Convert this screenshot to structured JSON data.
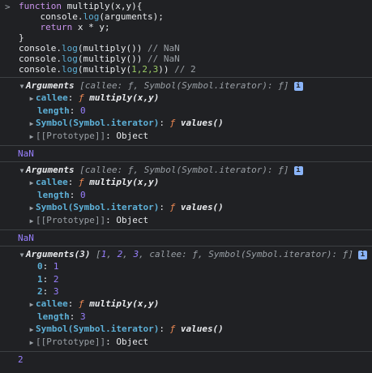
{
  "input": {
    "prompt_icon": "chevron-right-icon",
    "lines": [
      {
        "a": "function",
        "b": " multiply(x,y){"
      },
      {
        "a": "    console.",
        "b": "log",
        "c": "(arguments);"
      },
      {
        "a": "    return",
        "b": " x * y;"
      },
      {
        "a": "}"
      },
      {
        "a": "console.",
        "b": "log",
        "c": "(multiply()) ",
        "d": "// NaN"
      },
      {
        "a": "console.",
        "b": "log",
        "c": "(multiply()) ",
        "d": "// NaN"
      },
      {
        "a": "console.",
        "b": "log",
        "c": "(multiply(",
        "n": "1,2,3",
        "e": ")) ",
        "d": "// 2"
      }
    ]
  },
  "entries": [
    {
      "header_name": "Arguments",
      "header_preview": "[callee: ƒ, Symbol(Symbol.iterator): ƒ]",
      "info": "i",
      "rows": [
        {
          "key": "callee",
          "sep": ": ",
          "f": "ƒ",
          "val": " multiply(x,y)",
          "type": "func",
          "expandable": true
        },
        {
          "key": "length",
          "sep": ": ",
          "val": "0",
          "type": "num",
          "expandable": false
        },
        {
          "key": "Symbol(Symbol.iterator)",
          "sep": ": ",
          "f": "ƒ",
          "val": " values()",
          "type": "func",
          "expandable": true
        },
        {
          "key": "[[Prototype]]",
          "sep": ": ",
          "val": "Object",
          "type": "proto",
          "expandable": true
        }
      ]
    },
    {
      "nan": "NaN"
    },
    {
      "header_name": "Arguments",
      "header_preview": "[callee: ƒ, Symbol(Symbol.iterator): ƒ]",
      "info": "i",
      "rows": [
        {
          "key": "callee",
          "sep": ": ",
          "f": "ƒ",
          "val": " multiply(x,y)",
          "type": "func",
          "expandable": true
        },
        {
          "key": "length",
          "sep": ": ",
          "val": "0",
          "type": "num",
          "expandable": false
        },
        {
          "key": "Symbol(Symbol.iterator)",
          "sep": ": ",
          "f": "ƒ",
          "val": " values()",
          "type": "func",
          "expandable": true
        },
        {
          "key": "[[Prototype]]",
          "sep": ": ",
          "val": "Object",
          "type": "proto",
          "expandable": true
        }
      ]
    },
    {
      "nan": "NaN"
    },
    {
      "header_name": "Arguments(3)",
      "header_preview_parts": [
        "[",
        "1",
        ", ",
        "2",
        ", ",
        "3",
        ", callee: ƒ, Symbol(Symbol.iterator): ƒ]"
      ],
      "info": "i",
      "rows": [
        {
          "key": "0",
          "sep": ": ",
          "val": "1",
          "type": "num",
          "expandable": false
        },
        {
          "key": "1",
          "sep": ": ",
          "val": "2",
          "type": "num",
          "expandable": false
        },
        {
          "key": "2",
          "sep": ": ",
          "val": "3",
          "type": "num",
          "expandable": false
        },
        {
          "key": "callee",
          "sep": ": ",
          "f": "ƒ",
          "val": " multiply(x,y)",
          "type": "func",
          "expandable": true
        },
        {
          "key": "length",
          "sep": ": ",
          "val": "3",
          "type": "num",
          "expandable": false
        },
        {
          "key": "Symbol(Symbol.iterator)",
          "sep": ": ",
          "f": "ƒ",
          "val": " values()",
          "type": "func",
          "expandable": true
        },
        {
          "key": "[[Prototype]]",
          "sep": ": ",
          "val": "Object",
          "type": "proto",
          "expandable": true
        }
      ]
    }
  ],
  "result": "2",
  "colors": {
    "background": "#202124",
    "keyword": "#c792ea",
    "property": "#5db0d7",
    "number": "#9980ff",
    "function_glyph": "#f28b54",
    "comment": "#9aa0a6"
  }
}
